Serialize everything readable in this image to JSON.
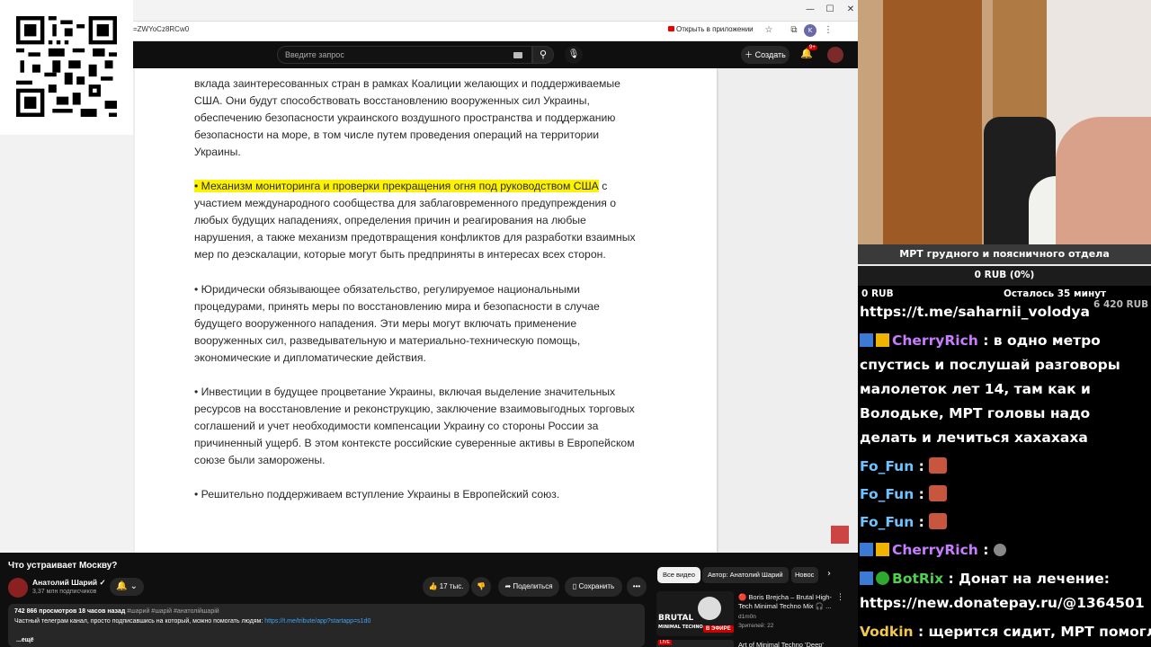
{
  "browser": {
    "url": "=ZWYoCz8RCw0",
    "open_in_app": "Открыть в приложении",
    "window_controls": [
      "—",
      "☐",
      "✕"
    ],
    "profile_initial": "K"
  },
  "youtube": {
    "search_placeholder": "Введите запрос",
    "create_label": "Создать",
    "notifications_badge": "9+"
  },
  "document": {
    "para0_line1": "вклада заинтересованных стран в рамках Коалиции желающих и поддерживаемые",
    "para0_rest": "США. Они будут способствовать восстановлению вооруженных сил Украины, обеспечению безопасности украинского воздушного пространства и поддержанию безопасности на море, в том числе путем проведения операций на территории Украины.",
    "para1_highlight": "• Механизм мониторинга и проверки прекращения огня под руководством США",
    "para1_rest": " с участием международного сообщества для заблаговременного предупреждения о любых будущих нападениях, определения причин и реагирования на любые нарушения, а также механизм предотвращения конфликтов для разработки взаимных мер по деэскалации, которые могут быть предприняты в интересах всех сторон.",
    "para2": "• Юридически обязывающее обязательство, регулируемое национальными процедурами, принять меры по восстановлению мира и безопасности в случае будущего вооруженного нападения. Эти меры могут включать применение вооруженных сил, разведывательную и материально-техническую помощь, экономические и дипломатические действия.",
    "para3": "• Инвестиции в будущее процветание Украины, включая выделение значительных ресурсов на восстановление и реконструкцию, заключение взаимовыгодных торговых соглашений и учет необходимости компенсации Украину со стороны России за причиненный ущерб. В этом контексте российские суверенные активы в Европейском союзе были заморожены.",
    "para4": "• Решительно поддерживаем вступление Украины в Европейский союз."
  },
  "video": {
    "title": "Что устраивает Москву?",
    "channel": "Анатолий Шарий ✓",
    "subscribers": "3,37 млн подписчиков",
    "likes": "17 тыс.",
    "share": "Поделиться",
    "save": "Сохранить",
    "more": "•••",
    "views_time": "742 866 просмотров  18 часов назад",
    "tags": "#шарий #шарій #анатолійшарій",
    "desc_text": "Частный телеграм канал, просто подписавшись на который, можно помогать людям: ",
    "desc_link": "https://t.me/tribute/app?startapp=s1d0",
    "desc_more": "...ещё"
  },
  "recommended": {
    "chips": [
      "Все видео",
      "Автор: Анатолий Шарий",
      "Новос"
    ],
    "item1_title": "🔴 Boris Brejcha – Brutal High-Tech Minimal Techno Mix 🎧 ...",
    "item1_channel": "d1m0n",
    "item1_viewers": "Зрителей: 22",
    "item1_thumb_text": "BRUTAL",
    "item1_thumb_sub": "MINIMAL TECHNO",
    "item1_live": "В ЭФИРЕ",
    "item2_title": "Art of Minimal Techno 'Deep'",
    "item2_live": "LIVE"
  },
  "stream": {
    "goal_title": "МРТ грудного и поясничного отдела",
    "goal_amount": "0 RUB (0%)",
    "goal_progress": 0,
    "goal_min": "0 RUB",
    "goal_left": "Осталось 35 минут",
    "goal_max": "6 420 RUB"
  },
  "chat": {
    "pinned_link": "https://t.me/saharnii_volodya",
    "messages": [
      {
        "nick": "CherryRich",
        "text": " : в одно метро спустись и послушай разговоры малолеток лет 14, там как и Володьке, МРТ головы надо делать и лечиться хахахаха"
      },
      {
        "nick": "Fo_Fun",
        "text": " : "
      },
      {
        "nick": "Fo_Fun",
        "text": " : "
      },
      {
        "nick": "Fo_Fun",
        "text": " : "
      },
      {
        "nick": "CherryRich",
        "text": " : "
      },
      {
        "nick": "BotRix",
        "text": " : Донат на лечение: https://new.donatepay.ru/@1364501"
      },
      {
        "nick": "Vodkin",
        "text": " : щерится сидит, МРТ помогло"
      }
    ]
  },
  "colors": {
    "highlight": "#fff200",
    "cherry": "#c77dff",
    "fofun": "#6ec2ff",
    "botrix": "#4fd14f",
    "vodkin": "#f2c94c"
  }
}
